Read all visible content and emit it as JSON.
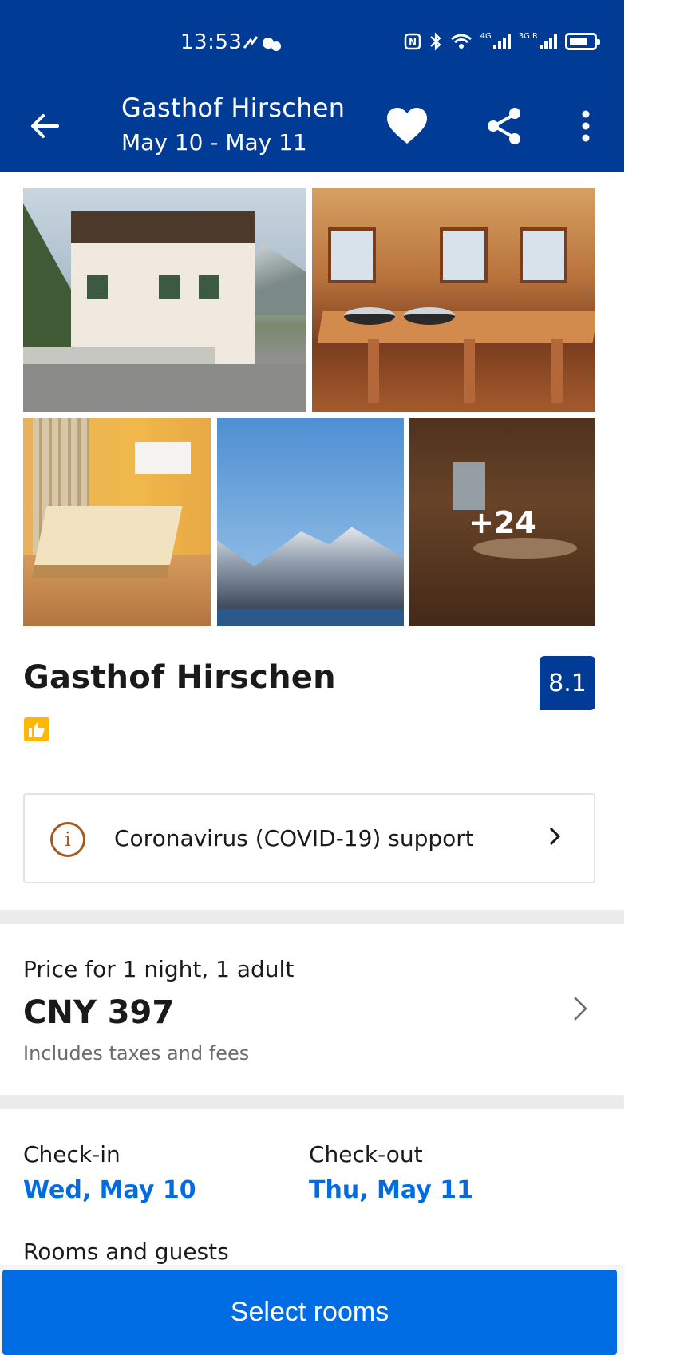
{
  "status_bar": {
    "time": "13:53",
    "network_left": "4G",
    "network_right": "3G R"
  },
  "app_bar": {
    "title": "Gasthof Hirschen",
    "dates": "May 10 - May 11",
    "icons": [
      "back-arrow-icon",
      "heart-icon",
      "share-icon",
      "more-vertical-icon"
    ]
  },
  "gallery": {
    "photos": [
      "hotel-exterior",
      "breakfast-room",
      "bedroom",
      "mountain-lake",
      "dining-room"
    ],
    "more_count": "+24"
  },
  "hotel": {
    "name": "Gasthof Hirschen",
    "score": "8.1",
    "badge_icon": "thumbs-up-icon"
  },
  "covid": {
    "label": "Coronavirus (COVID-19) support"
  },
  "price": {
    "label": "Price for 1 night, 1 adult",
    "value": "CNY 397",
    "note": "Includes taxes and fees"
  },
  "stay": {
    "checkin_label": "Check-in",
    "checkin_value": "Wed, May 10",
    "checkout_label": "Check-out",
    "checkout_value": "Thu, May 11",
    "rooms_label": "Rooms and guests"
  },
  "cta": {
    "label": "Select rooms"
  },
  "colors": {
    "brand_dark": "#003b95",
    "brand_blue": "#006ce4",
    "badge_yellow": "#ffb700",
    "info_brown": "#a35a1f"
  }
}
